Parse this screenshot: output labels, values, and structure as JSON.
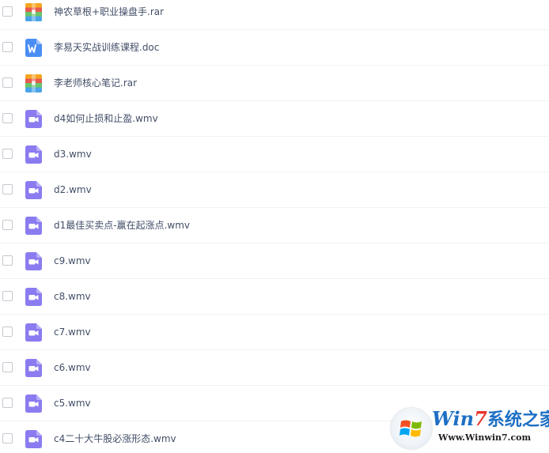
{
  "files": [
    {
      "name": "神农草根+职业操盘手.rar",
      "icon": "archive-icon",
      "type": "rar"
    },
    {
      "name": "李易天实战训练课程.doc",
      "icon": "word-doc-icon",
      "type": "doc"
    },
    {
      "name": "李老师核心笔记.rar",
      "icon": "archive-icon",
      "type": "rar"
    },
    {
      "name": "d4如何止损和止盈.wmv",
      "icon": "video-icon",
      "type": "wmv"
    },
    {
      "name": "d3.wmv",
      "icon": "video-icon",
      "type": "wmv"
    },
    {
      "name": "d2.wmv",
      "icon": "video-icon",
      "type": "wmv"
    },
    {
      "name": "d1最佳买卖点-赢在起涨点.wmv",
      "icon": "video-icon",
      "type": "wmv"
    },
    {
      "name": "c9.wmv",
      "icon": "video-icon",
      "type": "wmv"
    },
    {
      "name": "c8.wmv",
      "icon": "video-icon",
      "type": "wmv"
    },
    {
      "name": "c7.wmv",
      "icon": "video-icon",
      "type": "wmv"
    },
    {
      "name": "c6.wmv",
      "icon": "video-icon",
      "type": "wmv"
    },
    {
      "name": "c5.wmv",
      "icon": "video-icon",
      "type": "wmv"
    },
    {
      "name": "c4二十大牛股必涨形态.wmv",
      "icon": "video-icon",
      "type": "wmv"
    }
  ],
  "icon_colors": {
    "video": "#8a7cf0",
    "word": "#4a8ef5",
    "archive_stripes": [
      "#f5a623",
      "#e85a4f",
      "#6ac46a",
      "#4aa3e8"
    ]
  },
  "watermark": {
    "title_win": "Win",
    "title_seven": "7",
    "title_cn": "系统之家",
    "url": "Www.Winwin7.com"
  }
}
